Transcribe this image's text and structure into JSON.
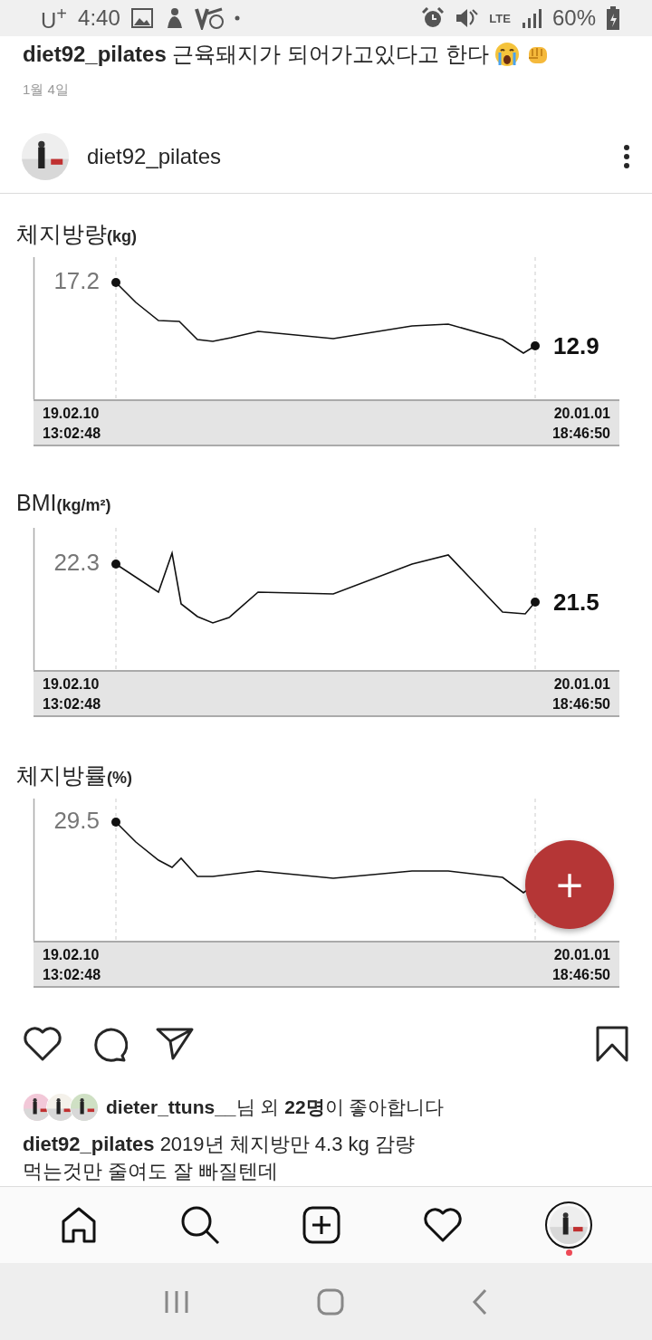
{
  "status_bar": {
    "carrier": "U$^{+}$",
    "time": "4:40",
    "network": "LTE",
    "battery": "60%"
  },
  "post_caption_top": {
    "username": "diet92_pilates",
    "text": "근육돼지가 되어가고있다고 한다"
  },
  "post_date": "1월 4일",
  "post_header": {
    "username": "diet92_pilates"
  },
  "charts": [
    {
      "title": "체지방량",
      "unit": "(kg)",
      "start_value": "17.2",
      "end_value": "12.9",
      "start_date": "19.02.10",
      "start_time": "13:02:48",
      "end_date": "20.01.01",
      "end_time": "18:46:50"
    },
    {
      "title": "BMI",
      "unit": "(kg/m²)",
      "start_value": "22.3",
      "end_value": "21.5",
      "start_date": "19.02.10",
      "start_time": "13:02:48",
      "end_date": "20.01.01",
      "end_time": "18:46:50"
    },
    {
      "title": "체지방률",
      "unit": "(%)",
      "start_value": "29.5",
      "start_date": "19.02.10",
      "start_time": "13:02:48",
      "end_date": "20.01.01",
      "end_time": "18:46:50"
    }
  ],
  "fab": {
    "label": "+"
  },
  "likes": {
    "text": "**dieter_ttuns__**님 외 **22명**이 좋아합니다"
  },
  "caption": [
    "**diet92_pilates** 2019년 체지방만 4.3 kg 감량",
    "먹는것만 줄여도 잘 빠질텐데"
  ]
}
